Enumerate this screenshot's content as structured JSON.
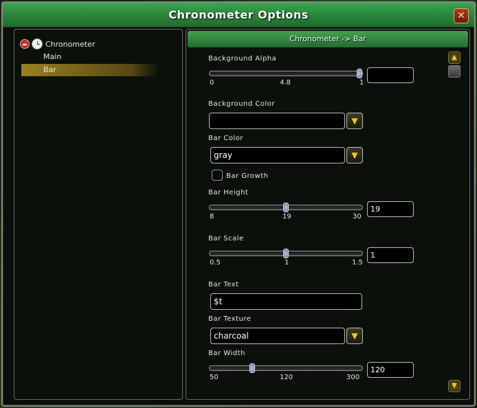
{
  "window": {
    "title": "Chronometer Options"
  },
  "tree": {
    "root_label": "Chronometer",
    "children": [
      {
        "label": "Main",
        "selected": false
      },
      {
        "label": "Bar",
        "selected": true
      }
    ]
  },
  "content": {
    "header": "Chronometer -> Bar",
    "background_alpha": {
      "label": "Background Alpha",
      "min": "0",
      "mid": "4.8",
      "max": "1",
      "value": "",
      "fraction": 0.98
    },
    "background_color": {
      "label": "Background Color",
      "value": ""
    },
    "bar_color": {
      "label": "Bar Color",
      "value": "gray"
    },
    "bar_growth": {
      "label": "Bar Growth",
      "checked": false
    },
    "bar_height": {
      "label": "Bar Height",
      "min": "8",
      "mid": "19",
      "max": "30",
      "value": "19",
      "fraction": 0.5
    },
    "bar_scale": {
      "label": "Bar Scale",
      "min": "0.5",
      "mid": "1",
      "max": "1.5",
      "value": "1",
      "fraction": 0.5
    },
    "bar_text": {
      "label": "Bar Text",
      "value": "$t"
    },
    "bar_texture": {
      "label": "Bar Texture",
      "value": "charcoal"
    },
    "bar_width": {
      "label": "Bar Width",
      "min": "50",
      "mid": "120",
      "max": "300",
      "value": "120",
      "fraction": 0.28
    }
  },
  "icons": {
    "close": "close-icon",
    "dropdown": "arrow-down-icon",
    "scroll_up": "scroll-up-icon",
    "scroll_down": "scroll-down-icon",
    "collapse": "collapse-minus-icon",
    "clock": "clock-icon"
  },
  "colors": {
    "title_green": "#2b8a3a",
    "selected_gold": "#aa8c1e",
    "dropdown_arrow": "#f2c81a"
  }
}
